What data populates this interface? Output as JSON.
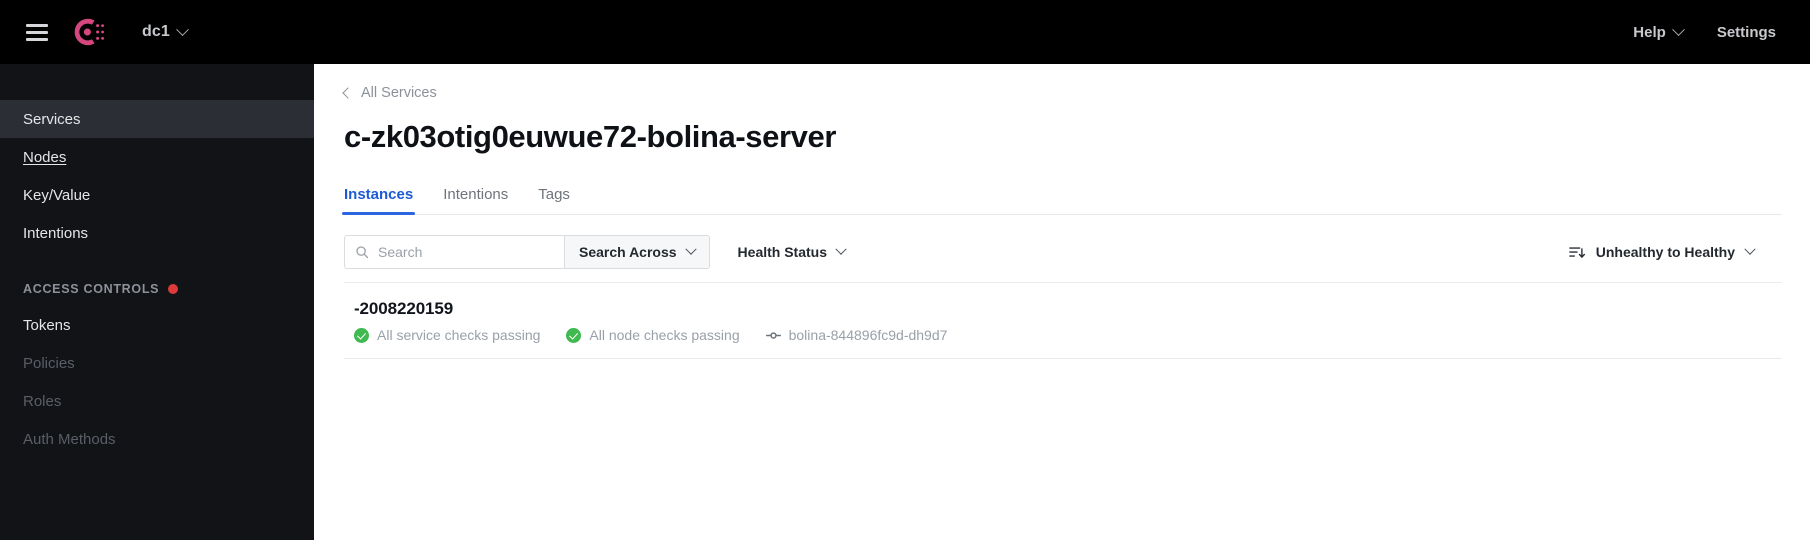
{
  "navbar": {
    "menu_icon": "hamburger-icon",
    "logo_icon": "consul-logo",
    "logo_color": "#d6477f",
    "datacenter": "dc1",
    "help_label": "Help",
    "settings_label": "Settings"
  },
  "sidebar": {
    "items": [
      {
        "label": "Services",
        "state": "active"
      },
      {
        "label": "Nodes",
        "state": "hovered"
      },
      {
        "label": "Key/Value",
        "state": "normal"
      },
      {
        "label": "Intentions",
        "state": "normal"
      }
    ],
    "section": {
      "heading": "ACCESS CONTROLS",
      "status_dot_color": "#dd3b3b",
      "items": [
        {
          "label": "Tokens",
          "state": "normal"
        },
        {
          "label": "Policies",
          "state": "disabled"
        },
        {
          "label": "Roles",
          "state": "disabled"
        },
        {
          "label": "Auth Methods",
          "state": "disabled"
        }
      ]
    }
  },
  "main": {
    "breadcrumb": "All Services",
    "title": "c-zk03otig0euwue72-bolina-server",
    "tabs": [
      {
        "label": "Instances",
        "active": true
      },
      {
        "label": "Intentions",
        "active": false
      },
      {
        "label": "Tags",
        "active": false
      }
    ],
    "filters": {
      "search_placeholder": "Search",
      "search_value": "",
      "search_icon": "search-icon",
      "search_across_label": "Search Across",
      "health_status_label": "Health Status",
      "sort_icon": "sort-descending-icon",
      "sort_label": "Unhealthy to Healthy"
    },
    "instances": [
      {
        "name": "-2008220159",
        "service_checks": "All service checks passing",
        "node_checks": "All node checks passing",
        "node": "bolina-844896fc9d-dh9d7",
        "status_color": "#3fb950"
      }
    ]
  }
}
